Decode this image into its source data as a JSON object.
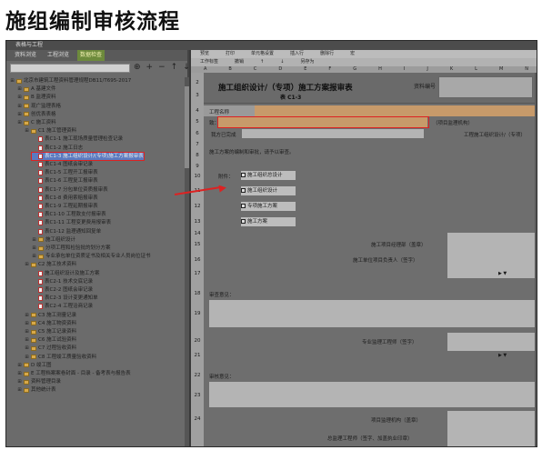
{
  "headline": "施组编制审核流程",
  "window": {
    "title": "表格与工程"
  },
  "left": {
    "tabs": [
      "资料浏览",
      "工程浏览",
      "数据检查"
    ],
    "tools": [
      "⊕",
      "+",
      "−",
      "↑",
      "↓"
    ],
    "tree": [
      {
        "label": "北京市建筑工程资料管理规程DB11/T695-2017",
        "depth": 0,
        "type": "folder"
      },
      {
        "label": "A 基建文件",
        "depth": 1,
        "type": "folder"
      },
      {
        "label": "B 监理资料",
        "depth": 1,
        "type": "folder"
      },
      {
        "label": "现广监理表格",
        "depth": 1,
        "type": "folder"
      },
      {
        "label": "创优表表格",
        "depth": 1,
        "type": "folder"
      },
      {
        "label": "C 施工资料",
        "depth": 1,
        "type": "folder"
      },
      {
        "label": "C1 施工管理资料",
        "depth": 2,
        "type": "folder"
      },
      {
        "label": "表C1-1 施工现场质量管理检查记录",
        "depth": 3,
        "type": "doc"
      },
      {
        "label": "表C1-2 施工日志",
        "depth": 3,
        "type": "doc"
      },
      {
        "label": "表C1-3 施工组织设计/(专项)施工方案报审表",
        "depth": 3,
        "type": "doc",
        "selected": true
      },
      {
        "label": "表C1-4 图纸会审记录",
        "depth": 3,
        "type": "doc"
      },
      {
        "label": "表C1-5 工程开工报审表",
        "depth": 3,
        "type": "doc"
      },
      {
        "label": "表C1-6 工程复工报审表",
        "depth": 3,
        "type": "doc"
      },
      {
        "label": "表C1-7 分包单位资质报审表",
        "depth": 3,
        "type": "doc"
      },
      {
        "label": "表C1-8 费用索赔报审表",
        "depth": 3,
        "type": "doc"
      },
      {
        "label": "表C1-9 工程延期报审表",
        "depth": 3,
        "type": "doc"
      },
      {
        "label": "表C1-10 工程款支付报审表",
        "depth": 3,
        "type": "doc"
      },
      {
        "label": "表C1-11 工程变更费用报审表",
        "depth": 3,
        "type": "doc"
      },
      {
        "label": "表C1-12 监理通知回复单",
        "depth": 3,
        "type": "doc"
      },
      {
        "label": "施工组织设计",
        "depth": 3,
        "type": "folder"
      },
      {
        "label": "分项工程和检验批的划分方案",
        "depth": 3,
        "type": "folder"
      },
      {
        "label": "专业承包单位资质证书及相关专业人员岗位证书",
        "depth": 3,
        "type": "folder"
      },
      {
        "label": "C2 施工技术资料",
        "depth": 2,
        "type": "folder"
      },
      {
        "label": "施工组织设计及施工方案",
        "depth": 3,
        "type": "doc"
      },
      {
        "label": "表C2-1 技术交底记录",
        "depth": 3,
        "type": "doc"
      },
      {
        "label": "表C2-2 图纸会审记录",
        "depth": 3,
        "type": "doc"
      },
      {
        "label": "表C2-3 设计变更通知单",
        "depth": 3,
        "type": "doc"
      },
      {
        "label": "表C2-4 工程洽商记录",
        "depth": 3,
        "type": "doc"
      },
      {
        "label": "C3 施工测量记录",
        "depth": 2,
        "type": "folder"
      },
      {
        "label": "C4 施工物资资料",
        "depth": 2,
        "type": "folder"
      },
      {
        "label": "C5 施工记录资料",
        "depth": 2,
        "type": "folder"
      },
      {
        "label": "C6 施工试验资料",
        "depth": 2,
        "type": "folder"
      },
      {
        "label": "C7 过程验收资料",
        "depth": 2,
        "type": "folder"
      },
      {
        "label": "C8 工程竣工质量验收资料",
        "depth": 2,
        "type": "folder"
      },
      {
        "label": "D 竣工图",
        "depth": 1,
        "type": "folder"
      },
      {
        "label": "E 工程档案案卷封面 - 目录 - 备考表与报告表",
        "depth": 1,
        "type": "folder"
      },
      {
        "label": "资料管理目录",
        "depth": 1,
        "type": "folder"
      },
      {
        "label": "其他统计表",
        "depth": 1,
        "type": "folder"
      }
    ]
  },
  "right": {
    "toolbar1": [
      "预览",
      "打印",
      "单元格设置",
      "插入行",
      "删除行",
      "宏"
    ],
    "toolbar2": [
      "工作标签",
      "撤销",
      "↑",
      "↓",
      "另存为"
    ],
    "columns": [
      "A",
      "B",
      "C",
      "D",
      "E",
      "F",
      "G",
      "H",
      "I",
      "J",
      "K",
      "L",
      "M",
      "N"
    ],
    "rows": [
      "2",
      "3",
      "4",
      "5",
      "6",
      "7",
      "8",
      "9",
      "10",
      "11",
      "12",
      "13",
      "14",
      "15",
      "16",
      "17",
      "18",
      "19",
      "20",
      "21",
      "22",
      "23",
      "24"
    ],
    "form": {
      "title": "施工组织设计/（专项）施工方案报审表",
      "code": "表 C1-3",
      "file_no_label": "资料编号",
      "project_label": "工程名称",
      "to_label": "致：",
      "to_suffix": "（项目监理机构）",
      "completed_label": "我方已完成",
      "completed_suffix": "工程施工组织设计/（专项）",
      "body": "施工方案的编制和审批，请予以审查。",
      "attach_label": "附件：",
      "options": [
        "施工组织总设计",
        "施工组织设计",
        "专项施工方案",
        "施工方案"
      ],
      "sign1": "施工项目经理部（盖章）",
      "sign2": "施工单位项目负责人（签字）",
      "review_label": "审查意见：",
      "sign3": "专业监理工程师（签字）",
      "audit_label": "审核意见：",
      "sign4": "项目监理机构（盖章）",
      "sign5": "总监理工程师（签字、加盖执业印章）"
    }
  },
  "colors": {
    "highlight": "#dd2222",
    "tab_active": "#6d8a3c",
    "project_band": "#c79a6a"
  }
}
